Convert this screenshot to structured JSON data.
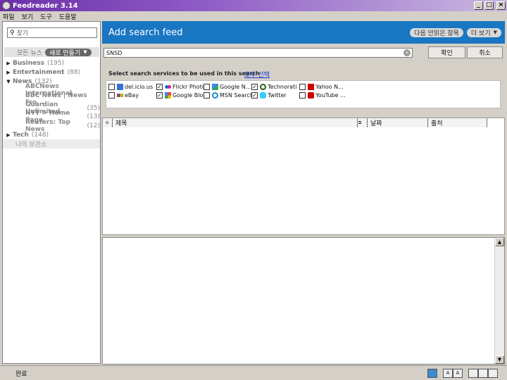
{
  "window": {
    "title": "Feedreader 3.14"
  },
  "menu": [
    "파일",
    "보기",
    "도구",
    "도움말"
  ],
  "sidebar": {
    "search_placeholder": "찾기",
    "all_news": "모든 뉴스",
    "new_button": "새로 만들기",
    "tree": [
      {
        "label": "Business",
        "count": "(195)",
        "expanded": false
      },
      {
        "label": "Entertainment",
        "count": "(88)",
        "expanded": false
      },
      {
        "label": "News",
        "count": "(132)",
        "expanded": true
      },
      {
        "label": "ABCNews International",
        "count": "",
        "child": true
      },
      {
        "label": "BBC News | News Fro...",
        "count": "",
        "child": true
      },
      {
        "label": "Guardian Unlimited",
        "count": "(35)",
        "child": true
      },
      {
        "label": "NYT > Home Page",
        "count": "(13)",
        "child": true
      },
      {
        "label": "Reuters: Top News",
        "count": "(12)",
        "child": true
      },
      {
        "label": "Tech",
        "count": "(148)",
        "expanded": false
      }
    ],
    "archive": "나의 보관소"
  },
  "banner": {
    "title": "Add search feed",
    "next_unread": "다음 안읽은 항목",
    "more": "더 보기"
  },
  "search": {
    "query": "SNSD",
    "ok_label": "확인",
    "cancel_label": "취소"
  },
  "services": {
    "title": "Select search services to be used in this search",
    "select_all": "모두 선택",
    "items": [
      {
        "name": "del.icio.us",
        "checked": false,
        "color": "#3274d1"
      },
      {
        "name": "Flickr Photo",
        "checked": true,
        "color": "#ff0084"
      },
      {
        "name": "Google N...",
        "checked": false,
        "color": "#3cba54"
      },
      {
        "name": "Technorati",
        "checked": true,
        "color": "#2b5f16"
      },
      {
        "name": "Yahoo N...",
        "checked": false,
        "color": "#cc0000"
      },
      {
        "name": "eBay",
        "checked": false,
        "color": "#e53238"
      },
      {
        "name": "Google Blog",
        "checked": true,
        "color": "#f4c20d"
      },
      {
        "name": "MSN Search",
        "checked": false,
        "color": "#1b8bd6"
      },
      {
        "name": "Twitter",
        "checked": true,
        "color": "#33ccff"
      },
      {
        "name": "YouTube ...",
        "checked": false,
        "color": "#cc0000"
      }
    ]
  },
  "table": {
    "columns": [
      "제목",
      "날짜",
      "출처"
    ]
  },
  "status": {
    "text": "완료"
  }
}
